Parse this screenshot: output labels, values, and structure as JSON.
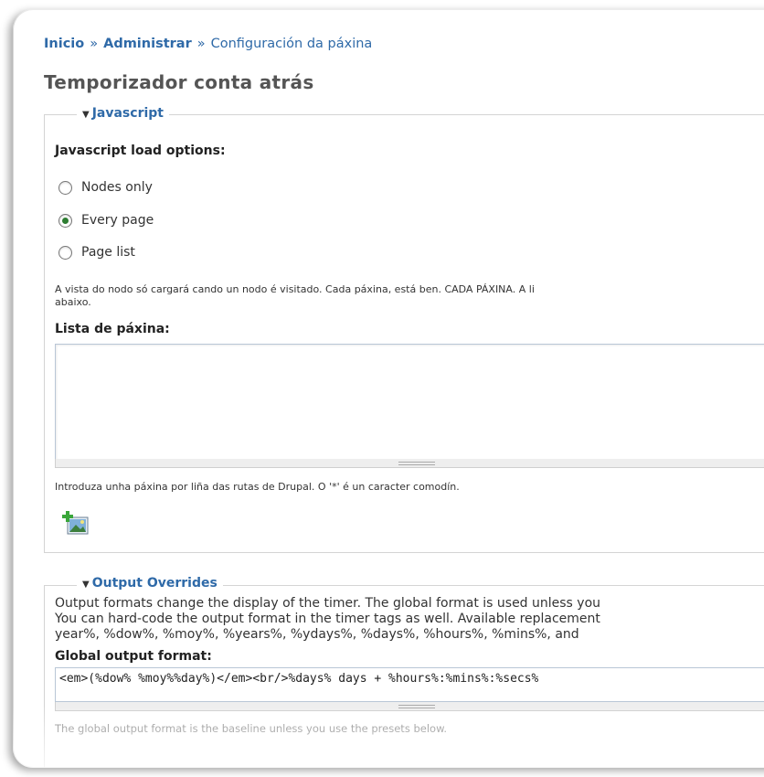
{
  "breadcrumb": {
    "items": [
      "Inicio",
      "Administrar",
      "Configuración da páxina"
    ],
    "separator": "»"
  },
  "page_title": "Temporizador conta atrás",
  "javascript_section": {
    "legend": "Javascript",
    "load_options_label": "Javascript load options:",
    "options": [
      {
        "label": "Nodes only",
        "checked": false
      },
      {
        "label": "Every page",
        "checked": true
      },
      {
        "label": "Page list",
        "checked": false
      }
    ],
    "options_help_line1": "A vista do nodo só cargará cando un nodo é visitado. Cada páxina, está ben. CADA PÁXINA. A li",
    "options_help_line2": "abaixo.",
    "page_list_label": "Lista de páxina:",
    "page_list_value": "",
    "page_list_help": "Introduza unha páxina por liña das rutas de Drupal. O '*' é un caracter comodín.",
    "add_icon": "add-image-icon"
  },
  "output_section": {
    "legend": "Output Overrides",
    "desc_line1": "Output formats change the display of the timer. The global format is used unless you",
    "desc_line2": "You can hard-code the output format in the timer tags as well. Available replacement",
    "desc_line3": "year%, %dow%, %moy%, %years%, %ydays%, %days%, %hours%, %mins%, and",
    "global_format_label": "Global output format:",
    "global_format_value": "<em>(%dow% %moy%%day%)</em><br/>%days% days + %hours%:%mins%:%secs%",
    "global_format_help": "The global output format is the baseline unless you use the presets below."
  },
  "colors": {
    "link": "#2f6aa8",
    "radio_checked": "#2e7d32",
    "border": "#d4d4d4"
  }
}
